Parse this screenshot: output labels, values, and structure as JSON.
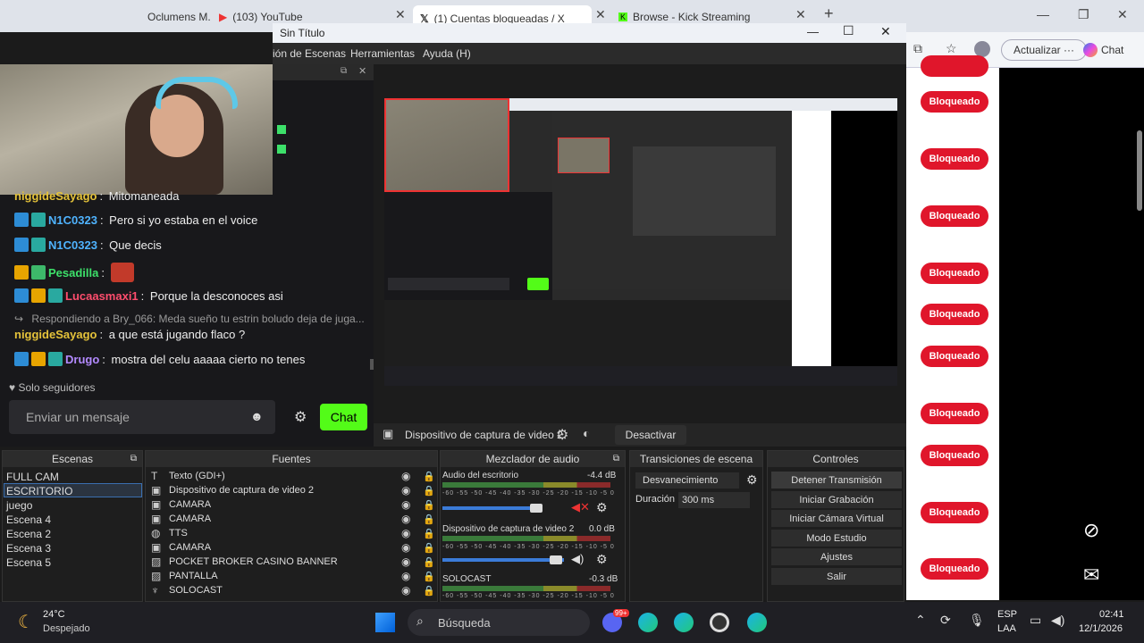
{
  "browser": {
    "tabs": [
      {
        "title": "Oclumens M..."
      },
      {
        "title": "(103) YouTube"
      },
      {
        "title": "(1) Cuentas bloqueadas / X"
      },
      {
        "title": "Browse - Kick Streaming"
      }
    ],
    "update_label": "Actualizar",
    "copilot_label": "Chat",
    "blocked_label": "Bloqueado",
    "blocked_count": 11
  },
  "obs": {
    "title": "Sin Título",
    "menu": [
      "ión de Escenas",
      "Herramientas",
      "Ayuda (H)"
    ],
    "capture_source": "Dispositivo de captura de video 2",
    "deactivate_label": "Desactivar",
    "docks": {
      "scenes_title": "Escenas",
      "sources_title": "Fuentes",
      "mixer_title": "Mezclador de audio",
      "transitions_title": "Transiciones de escena",
      "controls_title": "Controles"
    },
    "scenes": [
      "FULL CAM",
      "ESCRITORIO",
      "juego",
      "Escena 4",
      "Escena 2",
      "Escena 3",
      "Escena 5"
    ],
    "selected_scene": "ESCRITORIO",
    "sources": [
      {
        "icon": "T",
        "name": "Texto (GDI+)"
      },
      {
        "icon": "▣",
        "name": "Dispositivo de captura de video 2"
      },
      {
        "icon": "▣",
        "name": "CAMARA"
      },
      {
        "icon": "▣",
        "name": "CAMARA"
      },
      {
        "icon": "◍",
        "name": "TTS"
      },
      {
        "icon": "▣",
        "name": "CAMARA"
      },
      {
        "icon": "▨",
        "name": "POCKET BROKER CASINO BANNER"
      },
      {
        "icon": "▨",
        "name": "PANTALLA"
      },
      {
        "icon": "♆",
        "name": "SOLOCAST"
      }
    ],
    "mixer": [
      {
        "name": "Audio del escritorio",
        "db": "-4.4 dB"
      },
      {
        "name": "Dispositivo de captura de video 2",
        "db": "0.0 dB"
      },
      {
        "name": "SOLOCAST",
        "db": "-0.3 dB"
      }
    ],
    "mixer_scale": "-60 -55 -50 -45 -40 -35 -30 -25 -20 -15 -10 -5 0",
    "transition": "Desvanecimiento",
    "duration_label": "Duración",
    "duration_value": "300 ms",
    "controls": [
      "Detener Transmisión",
      "Iniciar Grabación",
      "Iniciar Cámara Virtual",
      "Modo Estudio",
      "Ajustes",
      "Salir"
    ]
  },
  "chat": {
    "lines": [
      {
        "user": "niggideSayago",
        "color": "#e5c33a",
        "msg": "Mitomaneada",
        "badges": []
      },
      {
        "user": "N1C0323",
        "color": "#4fb3ff",
        "msg": "Pero si yo estaba en el voice",
        "badges": [
          "b-blue",
          "b-teal"
        ]
      },
      {
        "user": "N1C0323",
        "color": "#4fb3ff",
        "msg": "Que decis",
        "badges": [
          "b-blue",
          "b-teal"
        ]
      },
      {
        "user": "Pesadilla",
        "color": "#3de06a",
        "msg": "",
        "badges": [
          "b-gold",
          "b-green"
        ]
      },
      {
        "user": "Lucaasmaxi1",
        "color": "#ff4d6d",
        "msg": "Porque la desconoces asi",
        "badges": [
          "b-blue",
          "b-gold",
          "b-teal"
        ]
      },
      {
        "user": "niggideSayago",
        "color": "#e5c33a",
        "msg": "a que está jugando flaco ?",
        "badges": []
      },
      {
        "user": "Drugo",
        "color": "#b38aff",
        "msg": "mostra del celu aaaaa cierto no tenes",
        "badges": [
          "b-blue",
          "b-gold",
          "b-teal"
        ]
      }
    ],
    "reply_text": "Respondiendo a Bry_066: Meda sueño tu estrin boludo deja de juga...",
    "followers_only": "Solo seguidores",
    "input_placeholder": "Enviar un mensaje",
    "chat_button": "Chat"
  },
  "taskbar": {
    "temp": "24°C",
    "weather": "Despejado",
    "search_placeholder": "Búsqueda",
    "lang1": "ESP",
    "lang2": "LAA",
    "time": "02:41",
    "date": "12/1/2026",
    "notif": "99+"
  },
  "colors": {
    "kick_green": "#53fc18",
    "blocked_red": "#e0162b"
  }
}
